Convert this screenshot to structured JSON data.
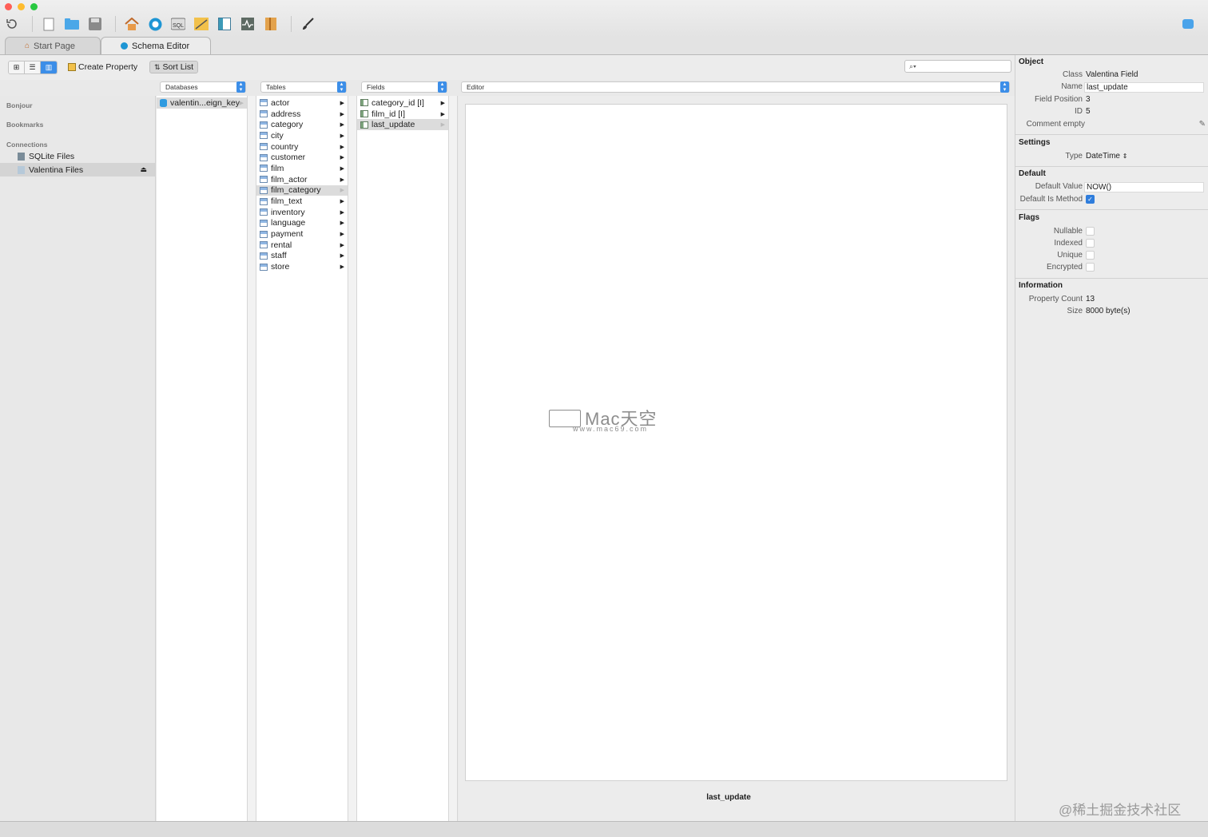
{
  "tabs": {
    "start_page": "Start Page",
    "schema_editor": "Schema Editor"
  },
  "toolbar": {
    "icons": [
      "refresh-icon",
      "new-file-icon",
      "open-folder-icon",
      "save-icon",
      "home-icon",
      "schema-icon",
      "sql-icon",
      "diagram-icon",
      "layout-icon",
      "activity-icon",
      "book-icon",
      "brush-icon"
    ],
    "accent": "#3c8ee8"
  },
  "subtoolbar": {
    "create_property": "Create Property",
    "sort_list": "Sort List"
  },
  "sidebar": {
    "bonjour": "Bonjour",
    "bookmarks": "Bookmarks",
    "connections": "Connections",
    "items": [
      {
        "label": "SQLite Files"
      },
      {
        "label": "Valentina Files"
      }
    ]
  },
  "columns": {
    "databases": "Databases",
    "tables": "Tables",
    "fields": "Fields",
    "editor": "Editor",
    "database_items": [
      "valentin...eign_key"
    ],
    "table_items": [
      "actor",
      "address",
      "category",
      "city",
      "country",
      "customer",
      "film",
      "film_actor",
      "film_category",
      "film_text",
      "inventory",
      "language",
      "payment",
      "rental",
      "staff",
      "store"
    ],
    "field_items": [
      "category_id [I]",
      "film_id [I]",
      "last_update"
    ]
  },
  "editor": {
    "caption": "last_update",
    "watermark_main": "Mac天空",
    "watermark_sub": "www.mac69.com"
  },
  "inspector": {
    "object": "Object",
    "class_label": "Class",
    "class_value": "Valentina Field",
    "name_label": "Name",
    "name_value": "last_update",
    "field_position_label": "Field Position",
    "field_position_value": "3",
    "id_label": "ID",
    "id_value": "5",
    "comment_label": "Comment",
    "comment_value": "empty",
    "settings": "Settings",
    "type_label": "Type",
    "type_value": "DateTime",
    "default": "Default",
    "default_value_label": "Default Value",
    "default_value_value": "NOW()",
    "default_is_method_label": "Default Is Method",
    "flags": "Flags",
    "nullable": "Nullable",
    "indexed": "Indexed",
    "unique": "Unique",
    "encrypted": "Encrypted",
    "information": "Information",
    "property_count_label": "Property Count",
    "property_count_value": "13",
    "size_label": "Size",
    "size_value": "8000 byte(s)"
  },
  "footer_mark": "@稀土掘金技术社区"
}
